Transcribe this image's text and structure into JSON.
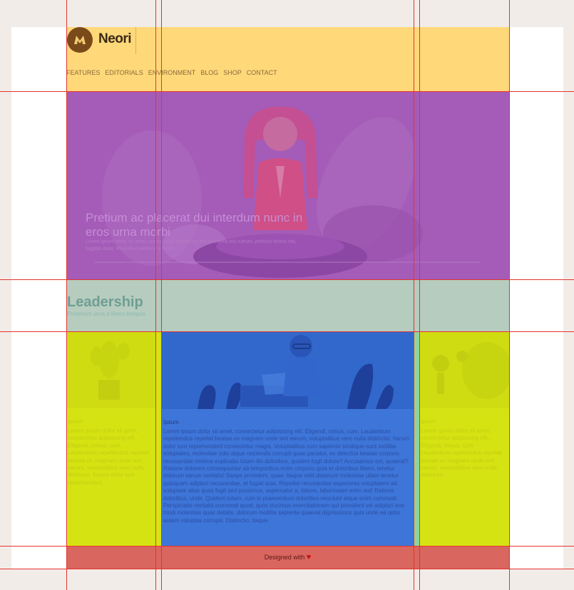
{
  "brand": {
    "name": "Neori"
  },
  "nav": [
    "FEATURES",
    "EDITORIALS",
    "ENVIRONMENT",
    "BLOG",
    "SHOP",
    "CONTACT"
  ],
  "hero": {
    "title": "Pretium ac placerat dui interdum nunc in eros urna morbi",
    "subtitle": "Lorem ipsum dolor sit amet, consectetur adipiscing elit ut viverra nisl rutrum, pretium lectus nisl, sagittis dolor. Phasellus eleifend efficitur..."
  },
  "leadership": {
    "title": "Leadership",
    "subtitle": "Pretenum urna a libero tempus"
  },
  "cards": {
    "left": {
      "label": "Ipsum",
      "text": "Lorem ipsum dolor sit amet, consectetur adipisicing elit. Eligendi, minus, cum. Laudantium repellendus repellat beatae ex magnam unde sint earum, voluptatibus vero nulla distinctio, harum dolor iure reprehenderit."
    },
    "main": {
      "label": "Ipsum",
      "text": "Lorem ipsum dolor sit amet, consectetur adipisicing elit. Eligendi, minus, cum. Laudantium repellendus repellat beatae ex magnam unde sint earum, voluptatibus vero nulla distinctio, harum dolor iure reprehenderit consectetur magni. Voluptatibus cum sapiente similique sunt mollitia voluptates, molestiae odio atque reiciendis corrupti quae pariatur, ex delectus beatae corporis recusandae minima explicabo totam illo doloribus, quidem fugit dolore? Accusamus est, quaerat? Ratione dolorem consequuntur ab temporibus enim corporis quia et doloribus libero, tenetur dolorum earum veritatis! Saepe provident, quae. Itaque velit deserunt molestiae ullam tenetur quisquam adipisci recusandae, et fugiat quia. Repellat recusandae asperiores voluptatem ad voluptate alias quas fugit sed possimus, aspernatur a, labore, laboriosam enim aut! Ratione doloribus, unde. Quidem totam, cum in praesentium doloribus nesciunt atque enim commodi. Perspiciatis veritatis commodi quod, quos ducimus exercitationem qui provident vel adipisci eos modi molestias quas debitis, dolorum mollitia sapiente quaerat dignissimos quis unde ea optio autem voluptas corrupti. Distinctio, itaque."
    },
    "right": {
      "label": "Ipsum",
      "text": "Lorem ipsum dolor sit amet, consectetur adipisicing elit. Eligendi, minus, cum. Laudantium repellendus repellat beatae ex magnam unde sint earum, voluptatibus vero nulla distinctio."
    }
  },
  "footer": {
    "text": "Designed with",
    "heart": "♥"
  },
  "colors": {
    "header": "#ffd879",
    "hero": "#a45cb8",
    "leadership": "#b5ccbe",
    "card_side": "#d6e312",
    "card_main": "#3e75d8",
    "footer": "#d9665f",
    "guides": "#e5332f"
  }
}
